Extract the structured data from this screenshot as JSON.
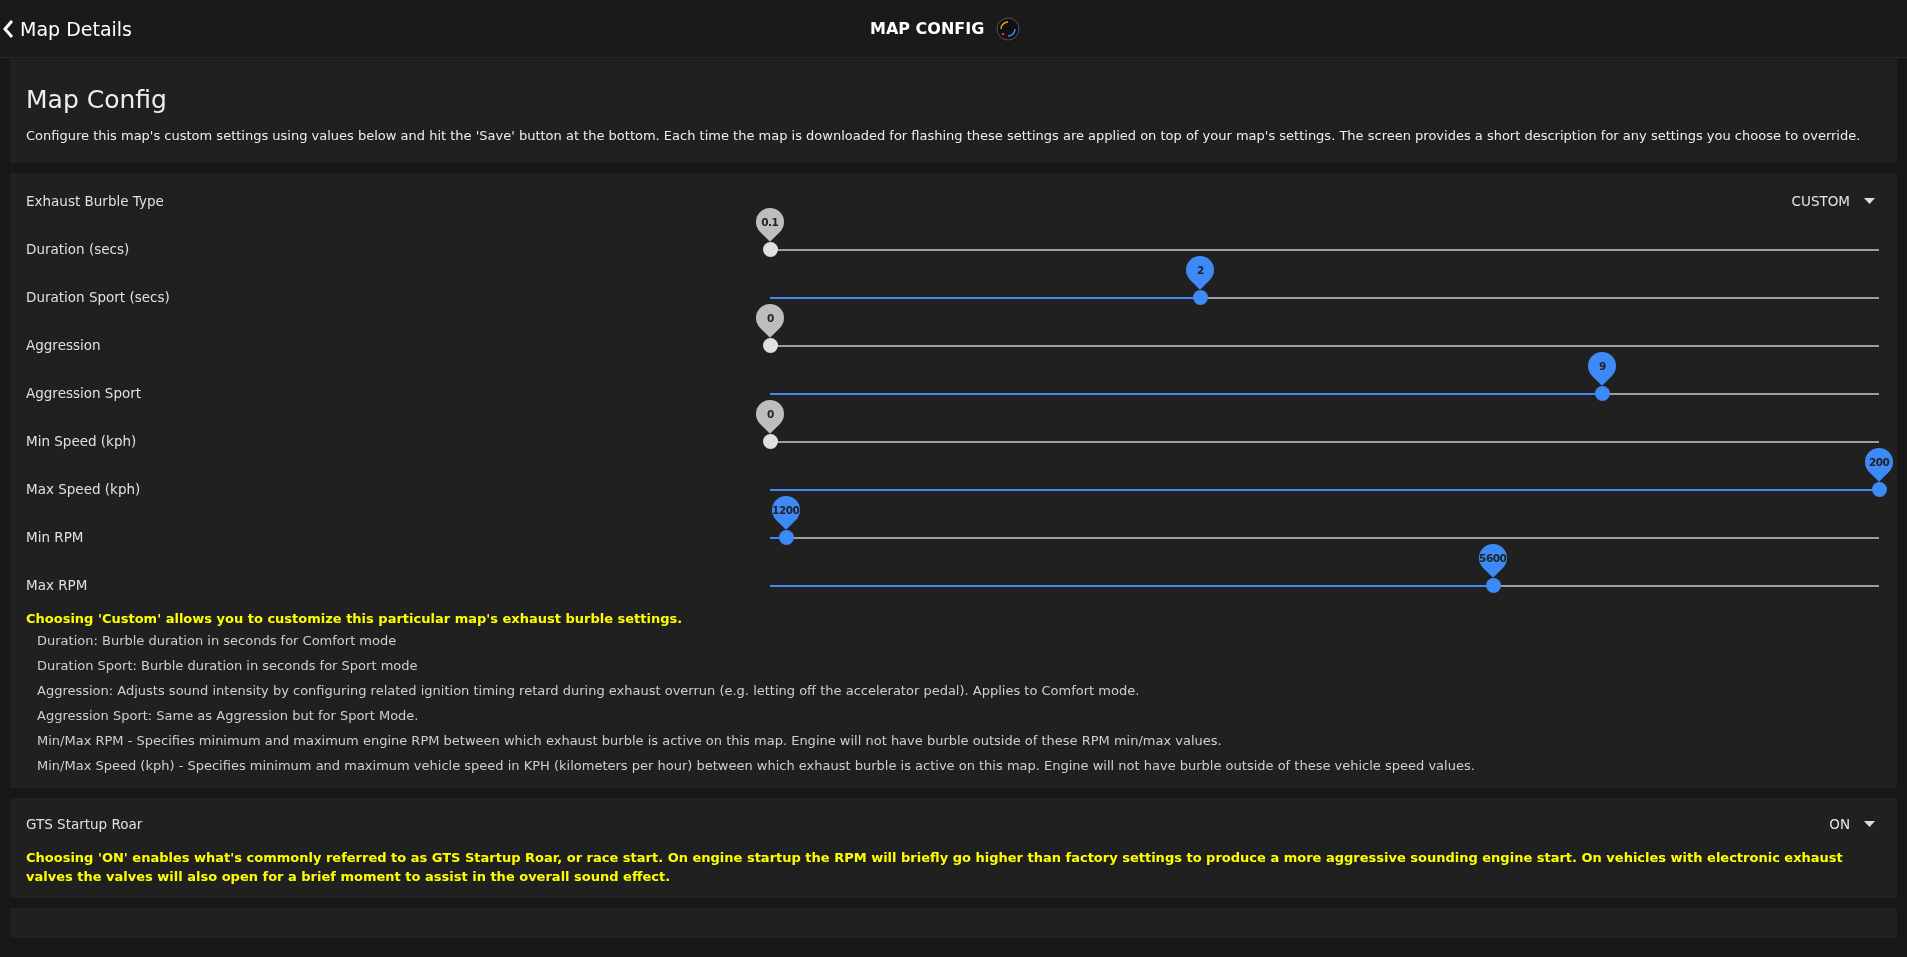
{
  "header": {
    "back_label": "Map Details",
    "title": "MAP CONFIG"
  },
  "intro": {
    "title": "Map Config",
    "description": "Configure this map's custom settings using values below and hit the 'Save' button at the bottom. Each time the map is downloaded for flashing these settings are applied on top of your map's settings. The screen provides a short description for any settings you choose to override."
  },
  "burble": {
    "type_label": "Exhaust Burble Type",
    "type_value": "CUSTOM",
    "sliders": [
      {
        "label": "Duration (secs)",
        "value": "0.1",
        "level": 0
      },
      {
        "label": "Duration Sport (secs)",
        "value": "2",
        "level": 0.388
      },
      {
        "label": "Aggression",
        "value": "0",
        "level": 0
      },
      {
        "label": "Aggression Sport",
        "value": "9",
        "level": 0.75
      },
      {
        "label": "Min Speed (kph)",
        "value": "0",
        "level": 0
      },
      {
        "label": "Max Speed (kph)",
        "value": "200",
        "level": 1
      },
      {
        "label": "Min RPM",
        "value": "1200",
        "level": 0.014
      },
      {
        "label": "Max RPM",
        "value": "5600",
        "level": 0.652
      }
    ],
    "note": "Choosing 'Custom' allows you to customize this particular map's exhaust burble settings.",
    "help": [
      "Duration: Burble duration in seconds for Comfort mode",
      "Duration Sport: Burble duration in seconds for Sport mode",
      "Aggression: Adjusts sound intensity by configuring related ignition timing retard during exhaust overrun (e.g. letting off the accelerator pedal). Applies to Comfort mode.",
      "Aggression Sport: Same as Aggression but for Sport Mode.",
      "Min/Max RPM - Specifies minimum and maximum engine RPM between which exhaust burble is active on this map. Engine will not have burble outside of these RPM min/max values.",
      "Min/Max Speed (kph) - Specifies minimum and maximum vehicle speed in KPH (kilometers per hour) between which exhaust burble is active on this map. Engine will not have burble outside of these vehicle speed values."
    ]
  },
  "startup": {
    "label": "GTS Startup Roar",
    "value": "ON",
    "note": "Choosing 'ON' enables what's commonly referred to as GTS Startup Roar, or race start. On engine startup the RPM will briefly go higher than factory settings to produce a more aggressive sounding engine start. On vehicles with electronic exhaust valves the valves will also open for a brief moment to assist in the overall sound effect."
  }
}
